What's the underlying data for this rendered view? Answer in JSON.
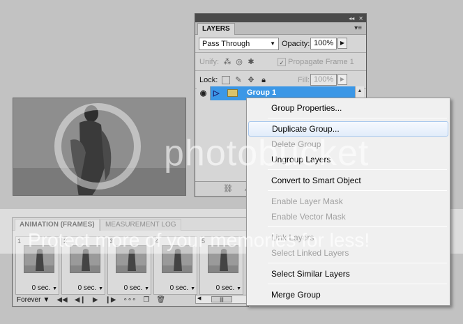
{
  "layers_panel": {
    "tab": "LAYERS",
    "blend_mode": "Pass Through",
    "opacity_label": "Opacity:",
    "opacity_value": "100%",
    "unify_label": "Unify:",
    "propagate_label": "Propagate Frame 1",
    "lock_label": "Lock:",
    "fill_label": "Fill:",
    "fill_value": "100%",
    "layer_name": "Group 1"
  },
  "animation_panel": {
    "tab_active": "ANIMATION (FRAMES)",
    "tab_inactive": "MEASUREMENT LOG",
    "frames": [
      {
        "num": "1",
        "delay": "0 sec."
      },
      {
        "num": "2",
        "delay": "0 sec."
      },
      {
        "num": "3",
        "delay": "0 sec."
      },
      {
        "num": "4",
        "delay": "0 sec."
      },
      {
        "num": "5",
        "delay": "0 sec."
      }
    ],
    "loop": "Forever"
  },
  "context_menu": {
    "items": [
      {
        "label": "Group Properties...",
        "state": "normal"
      },
      {
        "label": "Duplicate Group...",
        "state": "highlighted"
      },
      {
        "label": "Delete Group",
        "state": "disabled"
      },
      {
        "label": "Ungroup Layers",
        "state": "normal"
      },
      {
        "label": "Convert to Smart Object",
        "state": "normal"
      },
      {
        "label": "Enable Layer Mask",
        "state": "disabled"
      },
      {
        "label": "Enable Vector Mask",
        "state": "disabled"
      },
      {
        "label": "Link Layers",
        "state": "disabled"
      },
      {
        "label": "Select Linked Layers",
        "state": "disabled"
      },
      {
        "label": "Select Similar Layers",
        "state": "normal"
      },
      {
        "label": "Merge Group",
        "state": "normal"
      }
    ]
  },
  "watermark": {
    "brand": "photobucket",
    "promo": "Protect more of your memories for less!"
  },
  "colors": {
    "selection_blue": "#3b97e6",
    "menu_bg": "#f0f0f0",
    "workspace": "#c2c2c2"
  }
}
